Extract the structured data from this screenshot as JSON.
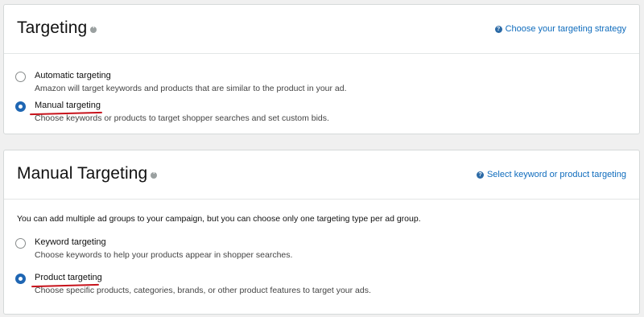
{
  "targeting_section": {
    "title": "Targeting",
    "help_link": "Choose your targeting strategy",
    "options": [
      {
        "label": "Automatic targeting",
        "description": "Amazon will target keywords and products that are similar to the product in your ad.",
        "selected": false
      },
      {
        "label": "Manual targeting",
        "description": "Choose keywords or products to target shopper searches and set custom bids.",
        "selected": true
      }
    ]
  },
  "manual_section": {
    "title": "Manual Targeting",
    "help_link": "Select keyword or product targeting",
    "intro": "You can add multiple ad groups to your campaign, but you can choose only one targeting type per ad group.",
    "options": [
      {
        "label": "Keyword targeting",
        "description": "Choose keywords to help your products appear in shopper searches.",
        "selected": false
      },
      {
        "label": "Product targeting",
        "description": "Choose specific products, categories, brands, or other product features to target your ads.",
        "selected": true
      }
    ]
  },
  "colors": {
    "accent": "#1f66b3",
    "link": "#0f6cbd",
    "annotation_underline": "#c7121b"
  },
  "icons": {
    "info": "info-icon",
    "help": "question-circle-icon"
  }
}
